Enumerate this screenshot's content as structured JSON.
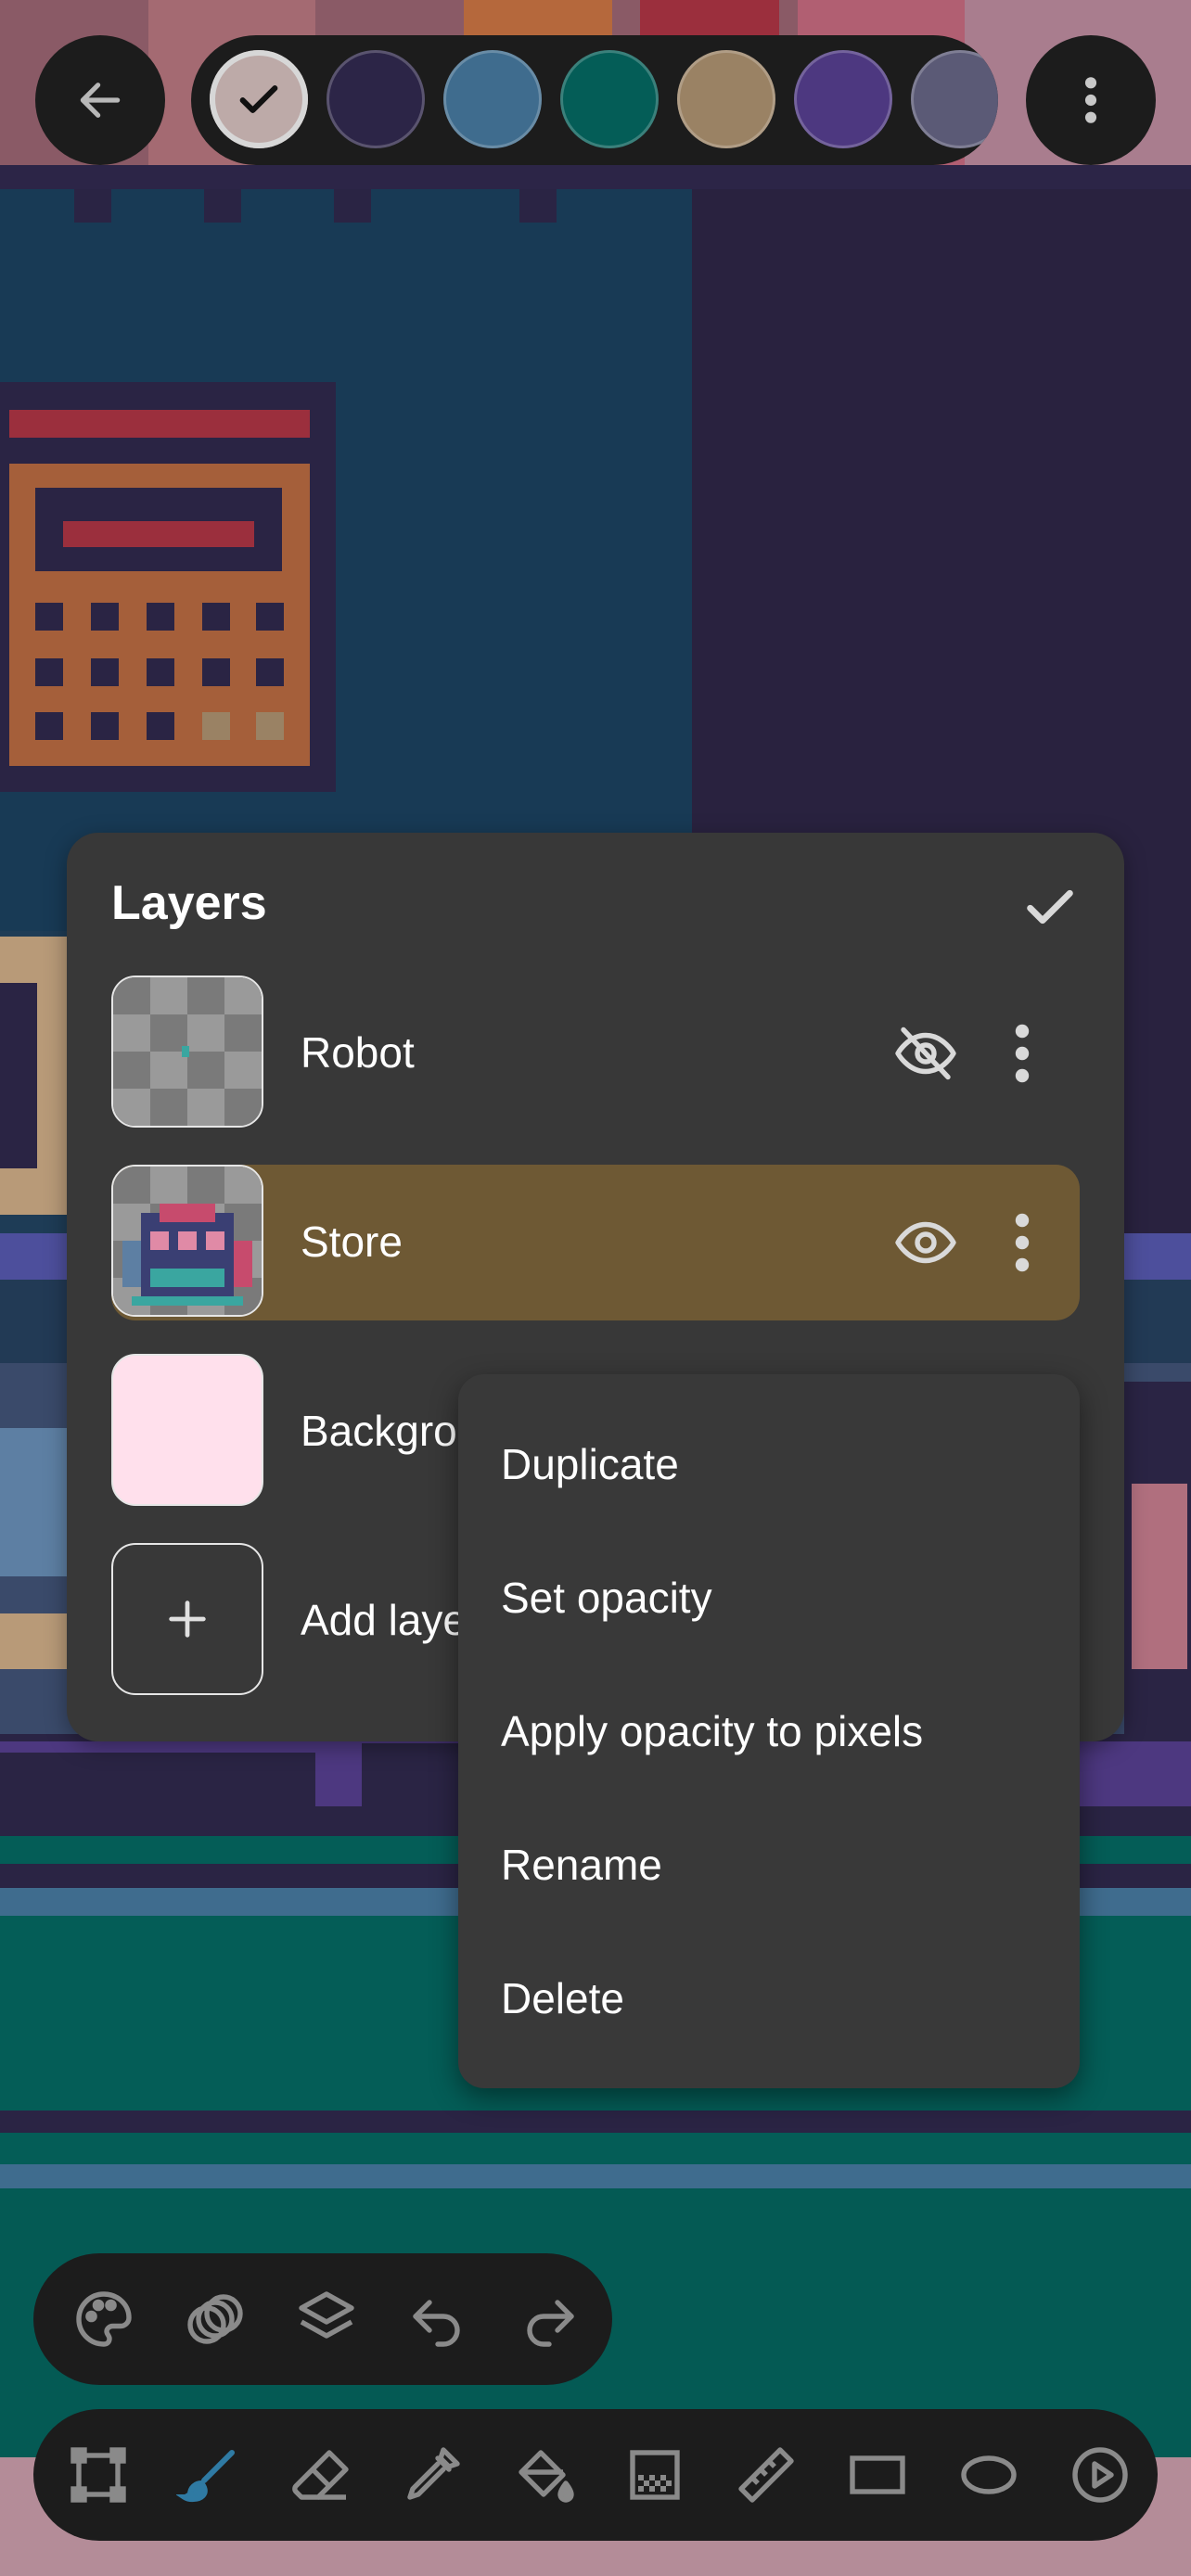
{
  "colors": {
    "panel": "#383838",
    "active_row": "#6e5934",
    "menu": "#393939",
    "bar": "#1c1c1c",
    "active_tool": "#2f7aa3"
  },
  "top_bar": {
    "back_icon": "arrow-left-icon",
    "more_icon": "more-vertical-icon",
    "swatches": [
      {
        "color": "#bdaaa8",
        "selected": true
      },
      {
        "color": "#2c2547"
      },
      {
        "color": "#3f6c8e"
      },
      {
        "color": "#045d57"
      },
      {
        "color": "#9a8264"
      },
      {
        "color": "#4d3880"
      },
      {
        "color": "#5b5a76"
      }
    ]
  },
  "layers_panel": {
    "title": "Layers",
    "confirm_icon": "check-icon",
    "layers": [
      {
        "name": "Robot",
        "visible": false,
        "visibility_icon": "eye-off-icon",
        "active": false
      },
      {
        "name": "Store",
        "visible": true,
        "visibility_icon": "eye-icon",
        "active": true
      },
      {
        "name": "Background",
        "active": false
      }
    ],
    "add_label": "Add layer",
    "add_icon": "plus-icon"
  },
  "context_menu": {
    "items": [
      "Duplicate",
      "Set opacity",
      "Apply opacity to pixels",
      "Rename",
      "Delete"
    ]
  },
  "secondary_toolbar": [
    "palette-icon",
    "blend-icon",
    "layers-icon",
    "undo-icon",
    "redo-icon"
  ],
  "main_toolbar": {
    "tools": [
      "select-icon",
      "brush-icon",
      "eraser-icon",
      "eyedropper-icon",
      "fill-bucket-icon",
      "dither-icon",
      "ruler-icon",
      "rectangle-icon",
      "ellipse-icon",
      "play-icon"
    ],
    "active_tool": "brush-icon"
  }
}
